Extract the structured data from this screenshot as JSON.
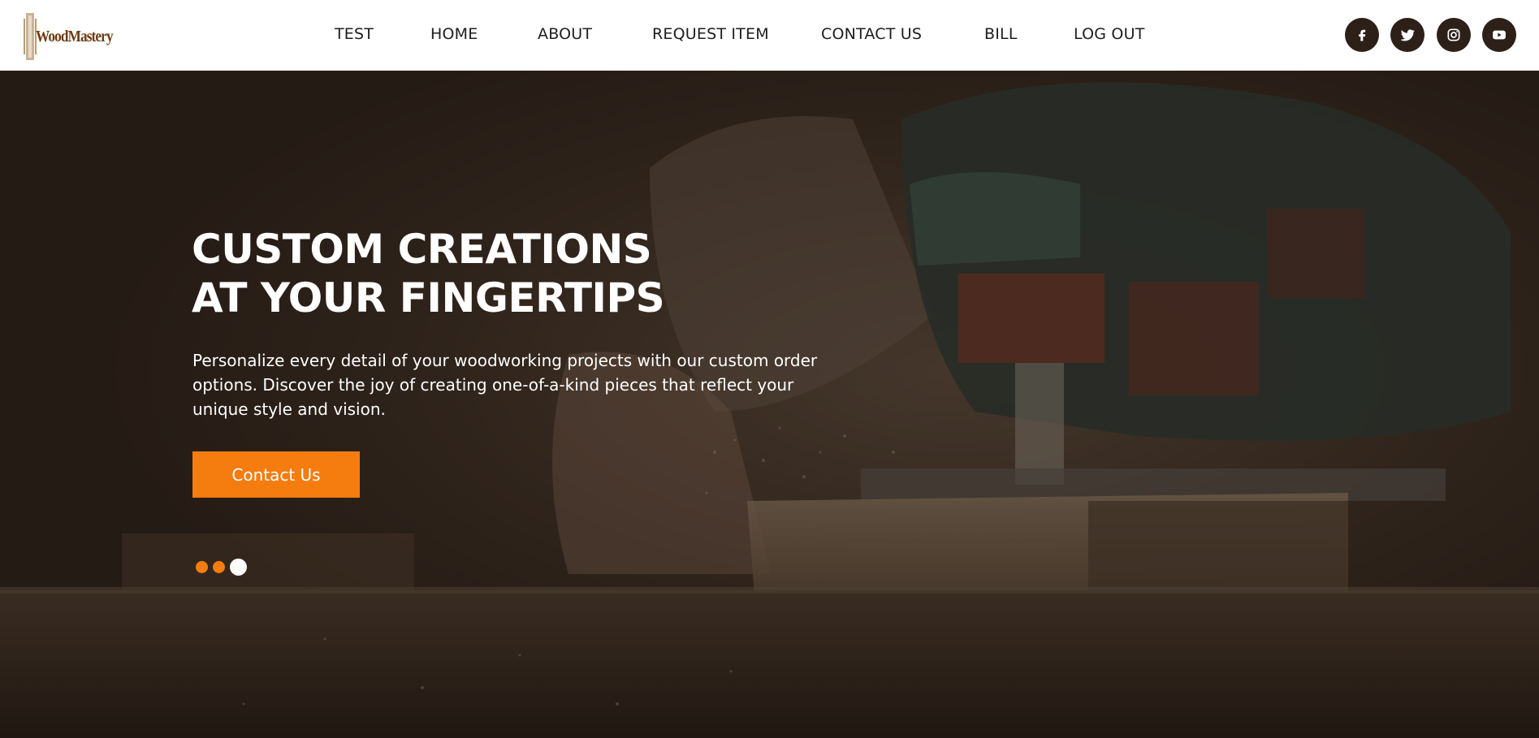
{
  "brand": {
    "logo_text": "WoodMastery"
  },
  "nav": {
    "items": [
      {
        "label": "TEST"
      },
      {
        "label": "HOME"
      },
      {
        "label": "ABOUT"
      },
      {
        "label": "REQUEST ITEM"
      },
      {
        "label": "CONTACT US"
      },
      {
        "label": "BILL"
      },
      {
        "label": "LOG OUT"
      }
    ]
  },
  "social": {
    "icons": [
      "facebook-icon",
      "twitter-icon",
      "instagram-icon",
      "youtube-icon"
    ],
    "background_color": "#2c2018"
  },
  "hero": {
    "headline_line1": "CUSTOM CREATIONS",
    "headline_line2": "AT YOUR FINGERTIPS",
    "description": "Personalize every detail of your woodworking projects with our custom order options. Discover the joy of creating one-of-a-kind pieces that reflect your unique style and vision.",
    "cta_label": "Contact Us",
    "accent_color": "#f57c0f",
    "slider": {
      "total": 3,
      "active_index": 3
    }
  }
}
